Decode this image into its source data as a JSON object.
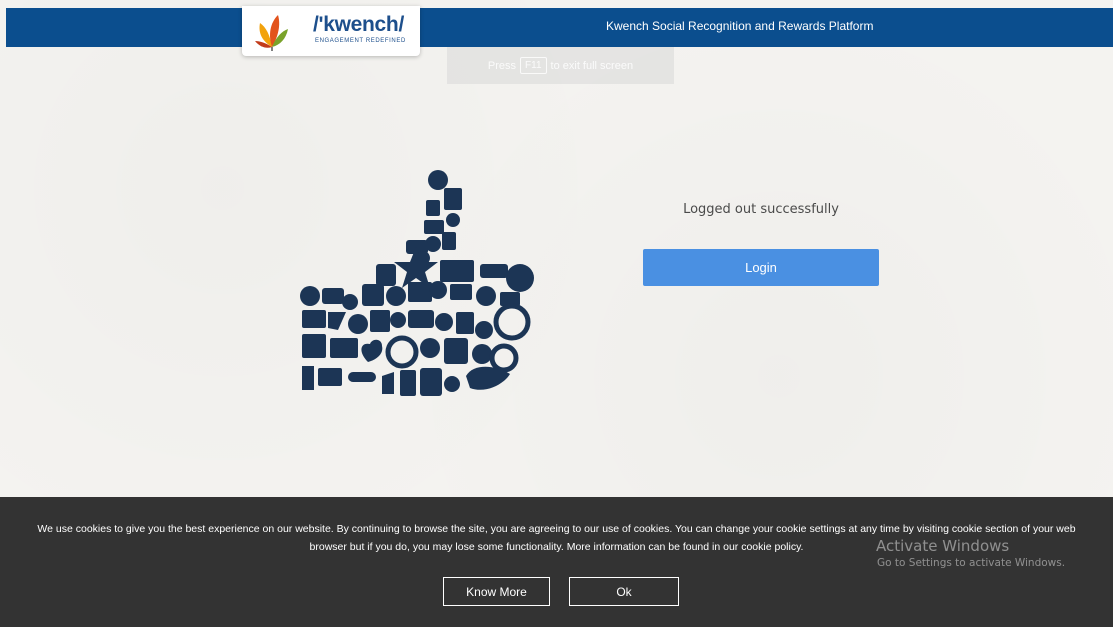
{
  "header": {
    "title": "Kwench Social Recognition and Rewards Platform",
    "logo_text": "/'kwench/",
    "logo_tagline": "ENGAGEMENT REDEFINED",
    "bar_color": "#0b4e8e"
  },
  "fullscreen_notice": {
    "prefix": "Press",
    "key": "F11",
    "suffix": "to exit full screen"
  },
  "illustration": {
    "icon": "thumbs-up-social-icons"
  },
  "main": {
    "status_message": "Logged out successfully",
    "login_label": "Login",
    "login_color": "#4a90e2"
  },
  "cookie_banner": {
    "text": "We use cookies to give you the best experience on our website. By continuing to browse the site, you are agreeing to our use of cookies. You can change your cookie settings at any time by visiting cookie section of your web browser but if you do, you may lose some functionality. More information can be found in our cookie policy.",
    "know_more_label": "Know More",
    "ok_label": "Ok"
  },
  "watermark": {
    "title": "Activate Windows",
    "subtitle": "Go to Settings to activate Windows."
  }
}
